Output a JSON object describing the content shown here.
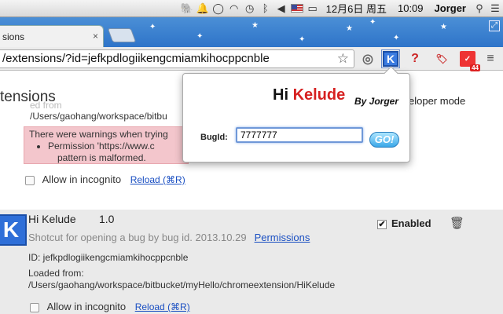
{
  "menubar": {
    "date": "12月6日 周五",
    "time": "10:09",
    "user": "Jorger"
  },
  "tab": {
    "title": "sions",
    "close": "×"
  },
  "omnibox": {
    "url": "/extensions/?id=jefkpdlogiikengcmiamkihocppcnble"
  },
  "toolbar": {
    "ext_badge": "44",
    "k_label": "K",
    "question": "?"
  },
  "page": {
    "title": "tensions",
    "developer_mode": "eloper mode",
    "loaded_from_faint": "ed from",
    "path_top": "/Users/gaohang/workspace/bitbu",
    "warning_line1": "There were warnings when trying",
    "warning_bullet": "Permission 'https://www.c",
    "warning_line2": "pattern is malformed.",
    "allow_incognito": "Allow in incognito",
    "reload": "Reload (⌘R)"
  },
  "extension": {
    "name": "Hi Kelude",
    "version": "1.0",
    "description": "Shotcut for opening a bug by bug id. 2013.10.29",
    "permissions": "Permissions",
    "id_line": "ID: jefkpdlogiikengcmiamkihocppcnble",
    "loaded_label": "Loaded from:",
    "loaded_path": "/Users/gaohang/workspace/bitbucket/myHello/chromeextension/HiKelude",
    "enabled": "Enabled",
    "allow_incognito": "Allow in incognito",
    "reload": "Reload (⌘R)"
  },
  "popup": {
    "title_hi": "Hi ",
    "title_kelude": "Kelude",
    "by": "By Jorger",
    "bugid_label": "BugId:",
    "bugid_value": "7777777",
    "go": "GO!"
  },
  "colors": {
    "accent": "#2f6fd8",
    "title_red": "#d62020",
    "warning_bg": "#f3c6cc"
  }
}
